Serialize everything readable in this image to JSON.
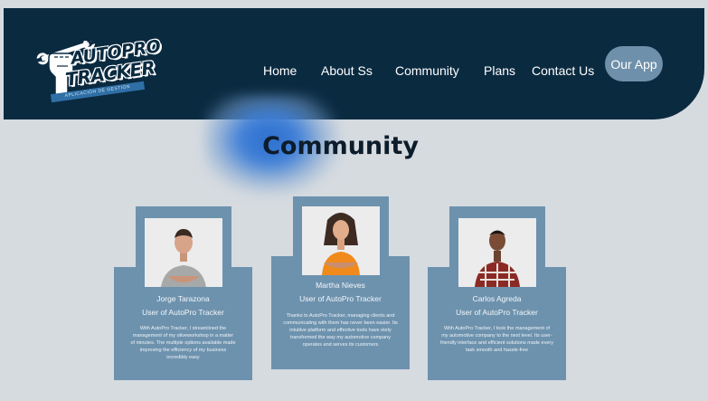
{
  "header": {
    "brand_line1": "AUTOPRO",
    "brand_line2": "TRACKER",
    "brand_tagline": "APLICACIÓN DE GESTIÓN",
    "nav": [
      "Home",
      "About Ss",
      "Community",
      "Plans",
      "Contact Us"
    ],
    "cta_label": "Our App"
  },
  "page": {
    "title": "Community"
  },
  "testimonials": [
    {
      "name": "Jorge Tarazona",
      "role": "User of AutoPro Tracker",
      "quote": "With AutoPro Tracker, I streamlined the management of my otiveworkshop in a matter of minutes. The multiple options available made improving the efficiency of my business incredibly easy"
    },
    {
      "name": "Martha Nieves",
      "role": "User of AutoPro Tracker",
      "quote": "Thanks to AutoPro Tracker, managing clients and communicating with them has never been easier. Its intuitive platform and effective tools have etely transformed the way my automotive company operates and serves its customers"
    },
    {
      "name": "Carlos Agreda",
      "role": "User of AutoPro Tracker",
      "quote": "With AutoPro Tracker, I took the management of my automotive company to the next level. Its user-friendly interface and efficient solutions made every task smooth and hassle-free"
    }
  ],
  "colors": {
    "header_bg": "#0a2a40",
    "page_bg": "#d6dbe0",
    "card_bg": "#6d92ae",
    "cta_bg": "#6f90aa",
    "glow": "#2d6fd0"
  }
}
